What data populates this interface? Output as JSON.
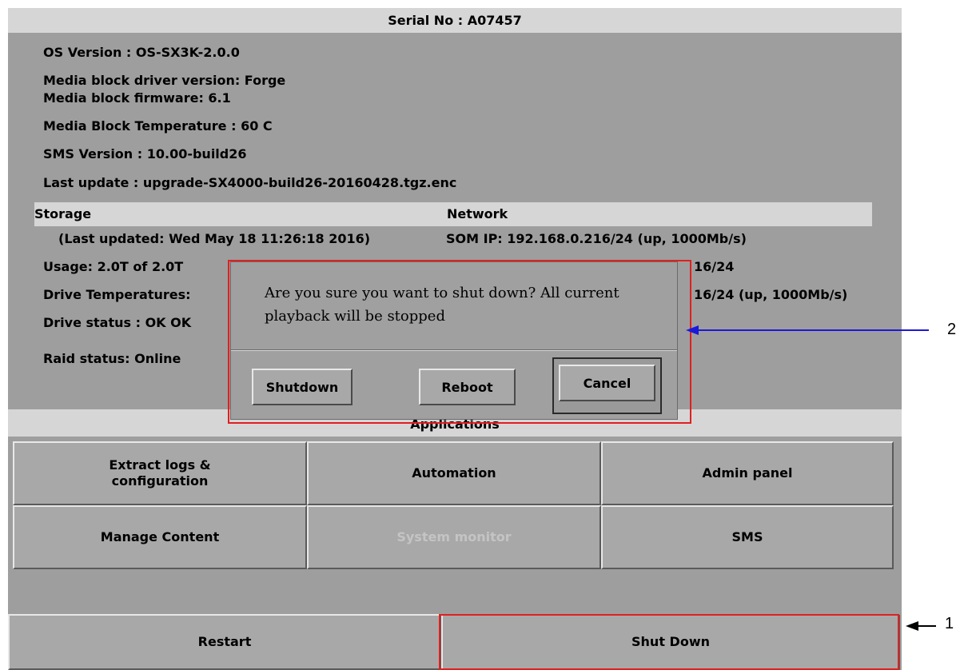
{
  "header": {
    "serial": "Serial No : A07457"
  },
  "info": {
    "os_version": "OS Version : OS-SX3K-2.0.0",
    "driver_version": "Media block driver version: Forge",
    "firmware": "Media block firmware: 6.1",
    "temperature": "Media Block Temperature : 60 C",
    "sms_version": "SMS Version : 10.00-build26",
    "last_update": "Last update : upgrade-SX4000-build26-20160428.tgz.enc"
  },
  "storage": {
    "heading": "Storage",
    "last_updated": "(Last updated: Wed May 18 11:26:18 2016)",
    "usage": "Usage: 2.0T of 2.0T",
    "drive_temps": "Drive Temperatures:",
    "drive_status": "Drive status : OK OK",
    "raid_status": "Raid status: Online"
  },
  "network": {
    "heading": "Network",
    "som_ip": "SOM IP: 192.168.0.216/24 (up, 1000Mb/s)",
    "ip2_partial": "16/24",
    "ip3_partial": "16/24 (up, 1000Mb/s)"
  },
  "applications": {
    "heading": "Applications",
    "buttons": [
      "Extract logs & configuration",
      "Automation",
      "Admin panel",
      "Manage Content",
      "System monitor",
      "SMS"
    ]
  },
  "bottom": {
    "restart": "Restart",
    "shutdown": "Shut Down"
  },
  "dialog": {
    "message": "Are you sure you want to shut down? All current playback will be stopped",
    "shutdown": "Shutdown",
    "reboot": "Reboot",
    "cancel": "Cancel"
  },
  "callouts": {
    "one": "1",
    "two": "2"
  },
  "colors": {
    "highlight": "#e02020",
    "arrow": "#1a1ad8"
  }
}
